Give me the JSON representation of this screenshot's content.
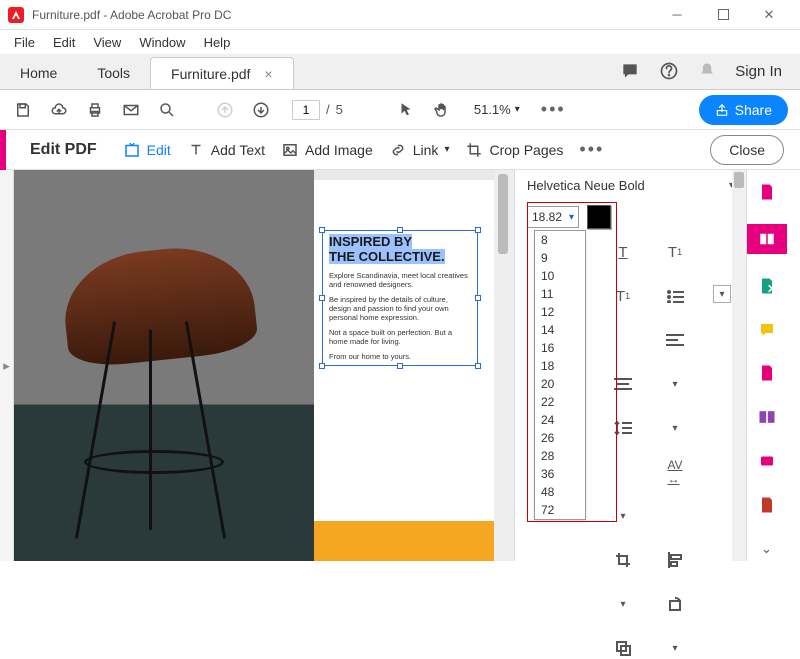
{
  "window": {
    "title": "Furniture.pdf - Adobe Acrobat Pro DC"
  },
  "menu": {
    "file": "File",
    "edit": "Edit",
    "view": "View",
    "window": "Window",
    "help": "Help"
  },
  "tabs": {
    "home": "Home",
    "tools": "Tools",
    "doc": "Furniture.pdf",
    "close": "×",
    "signin": "Sign In"
  },
  "toolbar": {
    "page_current": "1",
    "page_sep": "/",
    "page_total": "5",
    "zoom": "51.1%",
    "share": "Share"
  },
  "editbar": {
    "title": "Edit PDF",
    "edit": "Edit",
    "addtext": "Add Text",
    "addimage": "Add Image",
    "link": "Link",
    "crop": "Crop Pages",
    "close": "Close"
  },
  "doc": {
    "heading_a": "INSPIRED BY",
    "heading_b": "THE COLLECTIVE.",
    "p1": "Explore Scandinavia, meet local creatives and renowned designers.",
    "p2": "Be inspired by the details of culture, design and passion to find your own personal home expression.",
    "p3": "Not a space built on perfection. But a home made for living.",
    "p4": "From our home to yours."
  },
  "format": {
    "font": "Helvetica Neue Bold",
    "size": "18.82",
    "sizes": [
      "8",
      "9",
      "10",
      "11",
      "12",
      "14",
      "16",
      "18",
      "20",
      "22",
      "24",
      "26",
      "28",
      "36",
      "48",
      "72"
    ]
  }
}
